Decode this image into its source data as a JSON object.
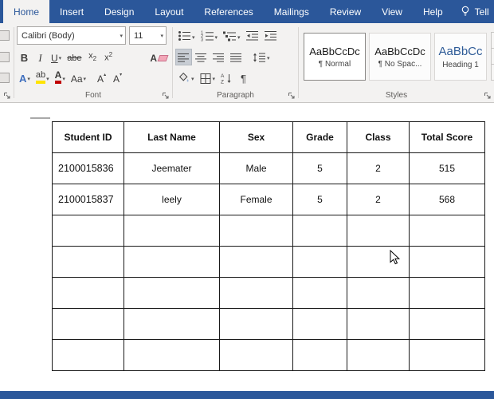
{
  "ribbon": {
    "tabs": [
      {
        "label": "Home",
        "active": true
      },
      {
        "label": "Insert"
      },
      {
        "label": "Design"
      },
      {
        "label": "Layout"
      },
      {
        "label": "References"
      },
      {
        "label": "Mailings"
      },
      {
        "label": "Review"
      },
      {
        "label": "View"
      },
      {
        "label": "Help"
      },
      {
        "label": "Tell"
      }
    ],
    "font": {
      "label": "Font",
      "font_name": "Calibri (Body)",
      "font_size": "11",
      "bold": "B",
      "italic": "I",
      "underline": "U",
      "strikethrough": "abe",
      "subscript": {
        "base": "x",
        "mark": "2"
      },
      "superscript": {
        "base": "x",
        "mark": "2"
      },
      "clear_formatting": "A",
      "text_effects": "A",
      "highlight": "ab",
      "font_color": "A",
      "change_case": "Aa",
      "grow_font": "A",
      "shrink_font": "A"
    },
    "paragraph": {
      "label": "Paragraph",
      "pilcrow": "¶",
      "sort_a": "A",
      "sort_z": "Z"
    },
    "styles": {
      "label": "Styles",
      "items": [
        {
          "preview": "AaBbCcDc",
          "name": "¶ Normal",
          "selected": true
        },
        {
          "preview": "AaBbCcDc",
          "name": "¶ No Spac...",
          "selected": false
        },
        {
          "preview": "AaBbCc",
          "name": "Heading 1",
          "selected": false
        }
      ]
    },
    "icons": {
      "dropdown_arrow": "▾",
      "tri_up": "▴",
      "tri_down": "▾",
      "scroll_up": "▴",
      "scroll_down": "▾",
      "lightbulb": "tell-me-lightbulb",
      "bullets": "bullet-list-icon",
      "numbering": "numbered-list-icon",
      "multilevel": "multilevel-list-icon",
      "decrease_indent": "decrease-indent-icon",
      "increase_indent": "increase-indent-icon",
      "align_left": "align-left-icon",
      "align_center": "align-center-icon",
      "align_right": "align-right-icon",
      "justify": "justify-icon",
      "line_spacing": "line-spacing-icon",
      "shading": "shading-bucket-icon",
      "borders": "borders-grid-icon",
      "sort": "sort-az-icon",
      "dialog_launcher": "dialog-launcher-corner-arrow",
      "cursor": "mouse-arrow-pointer"
    }
  },
  "document": {
    "table": {
      "headers": [
        "Student ID",
        "Last Name",
        "Sex",
        "Grade",
        "Class",
        "Total Score"
      ],
      "rows": [
        [
          "2100015836",
          "Jeemater",
          "Male",
          "5",
          "2",
          "515"
        ],
        [
          "2100015837",
          "leely",
          "Female",
          "5",
          "2",
          "568"
        ],
        [
          "",
          "",
          "",
          "",
          "",
          ""
        ],
        [
          "",
          "",
          "",
          "",
          "",
          ""
        ],
        [
          "",
          "",
          "",
          "",
          "",
          ""
        ],
        [
          "",
          "",
          "",
          "",
          "",
          ""
        ],
        [
          "",
          "",
          "",
          "",
          "",
          ""
        ]
      ]
    }
  },
  "colors": {
    "ribbon_blue": "#2b579a",
    "heading_style_blue": "#2e5b97",
    "highlight_yellow": "#ffe400",
    "font_color_red": "#c00000"
  }
}
